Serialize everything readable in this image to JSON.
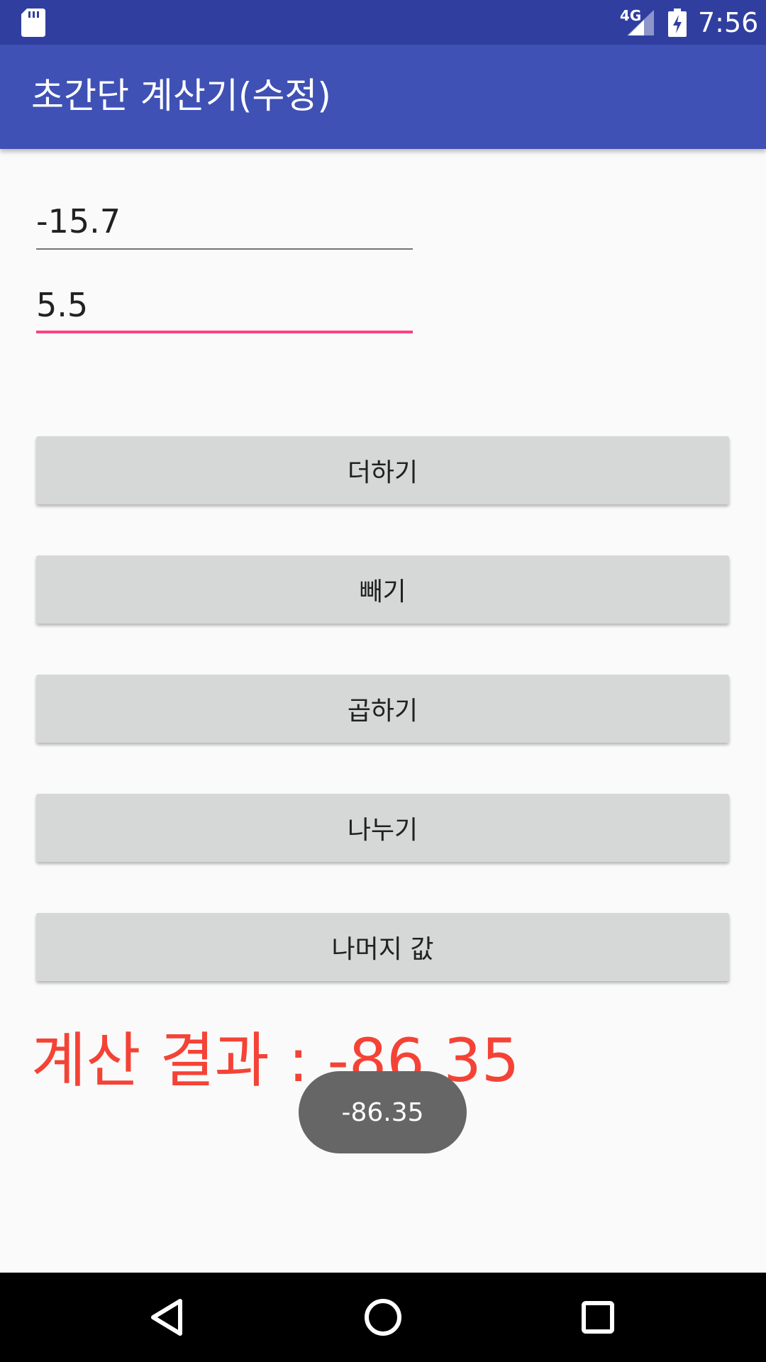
{
  "status_bar": {
    "network": "4G",
    "time": "7:56",
    "icons": [
      "sd-card-icon",
      "signal-icon",
      "battery-charging-icon"
    ]
  },
  "app_bar": {
    "title": "초간단 계산기(수정)"
  },
  "inputs": {
    "first_value": "-15.7",
    "second_value": "5.5"
  },
  "buttons": {
    "add": "더하기",
    "subtract": "빼기",
    "multiply": "곱하기",
    "divide": "나누기",
    "remainder": "나머지 값"
  },
  "result": {
    "text": "계산 결과 : -86.35",
    "color": "#f44336"
  },
  "toast": {
    "text": "-86.35"
  },
  "nav_bar": {
    "icons": [
      "back-icon",
      "home-icon",
      "recents-icon"
    ]
  },
  "colors": {
    "primary_dark": "#303f9f",
    "primary": "#3f51b5",
    "accent": "#ff4081"
  }
}
